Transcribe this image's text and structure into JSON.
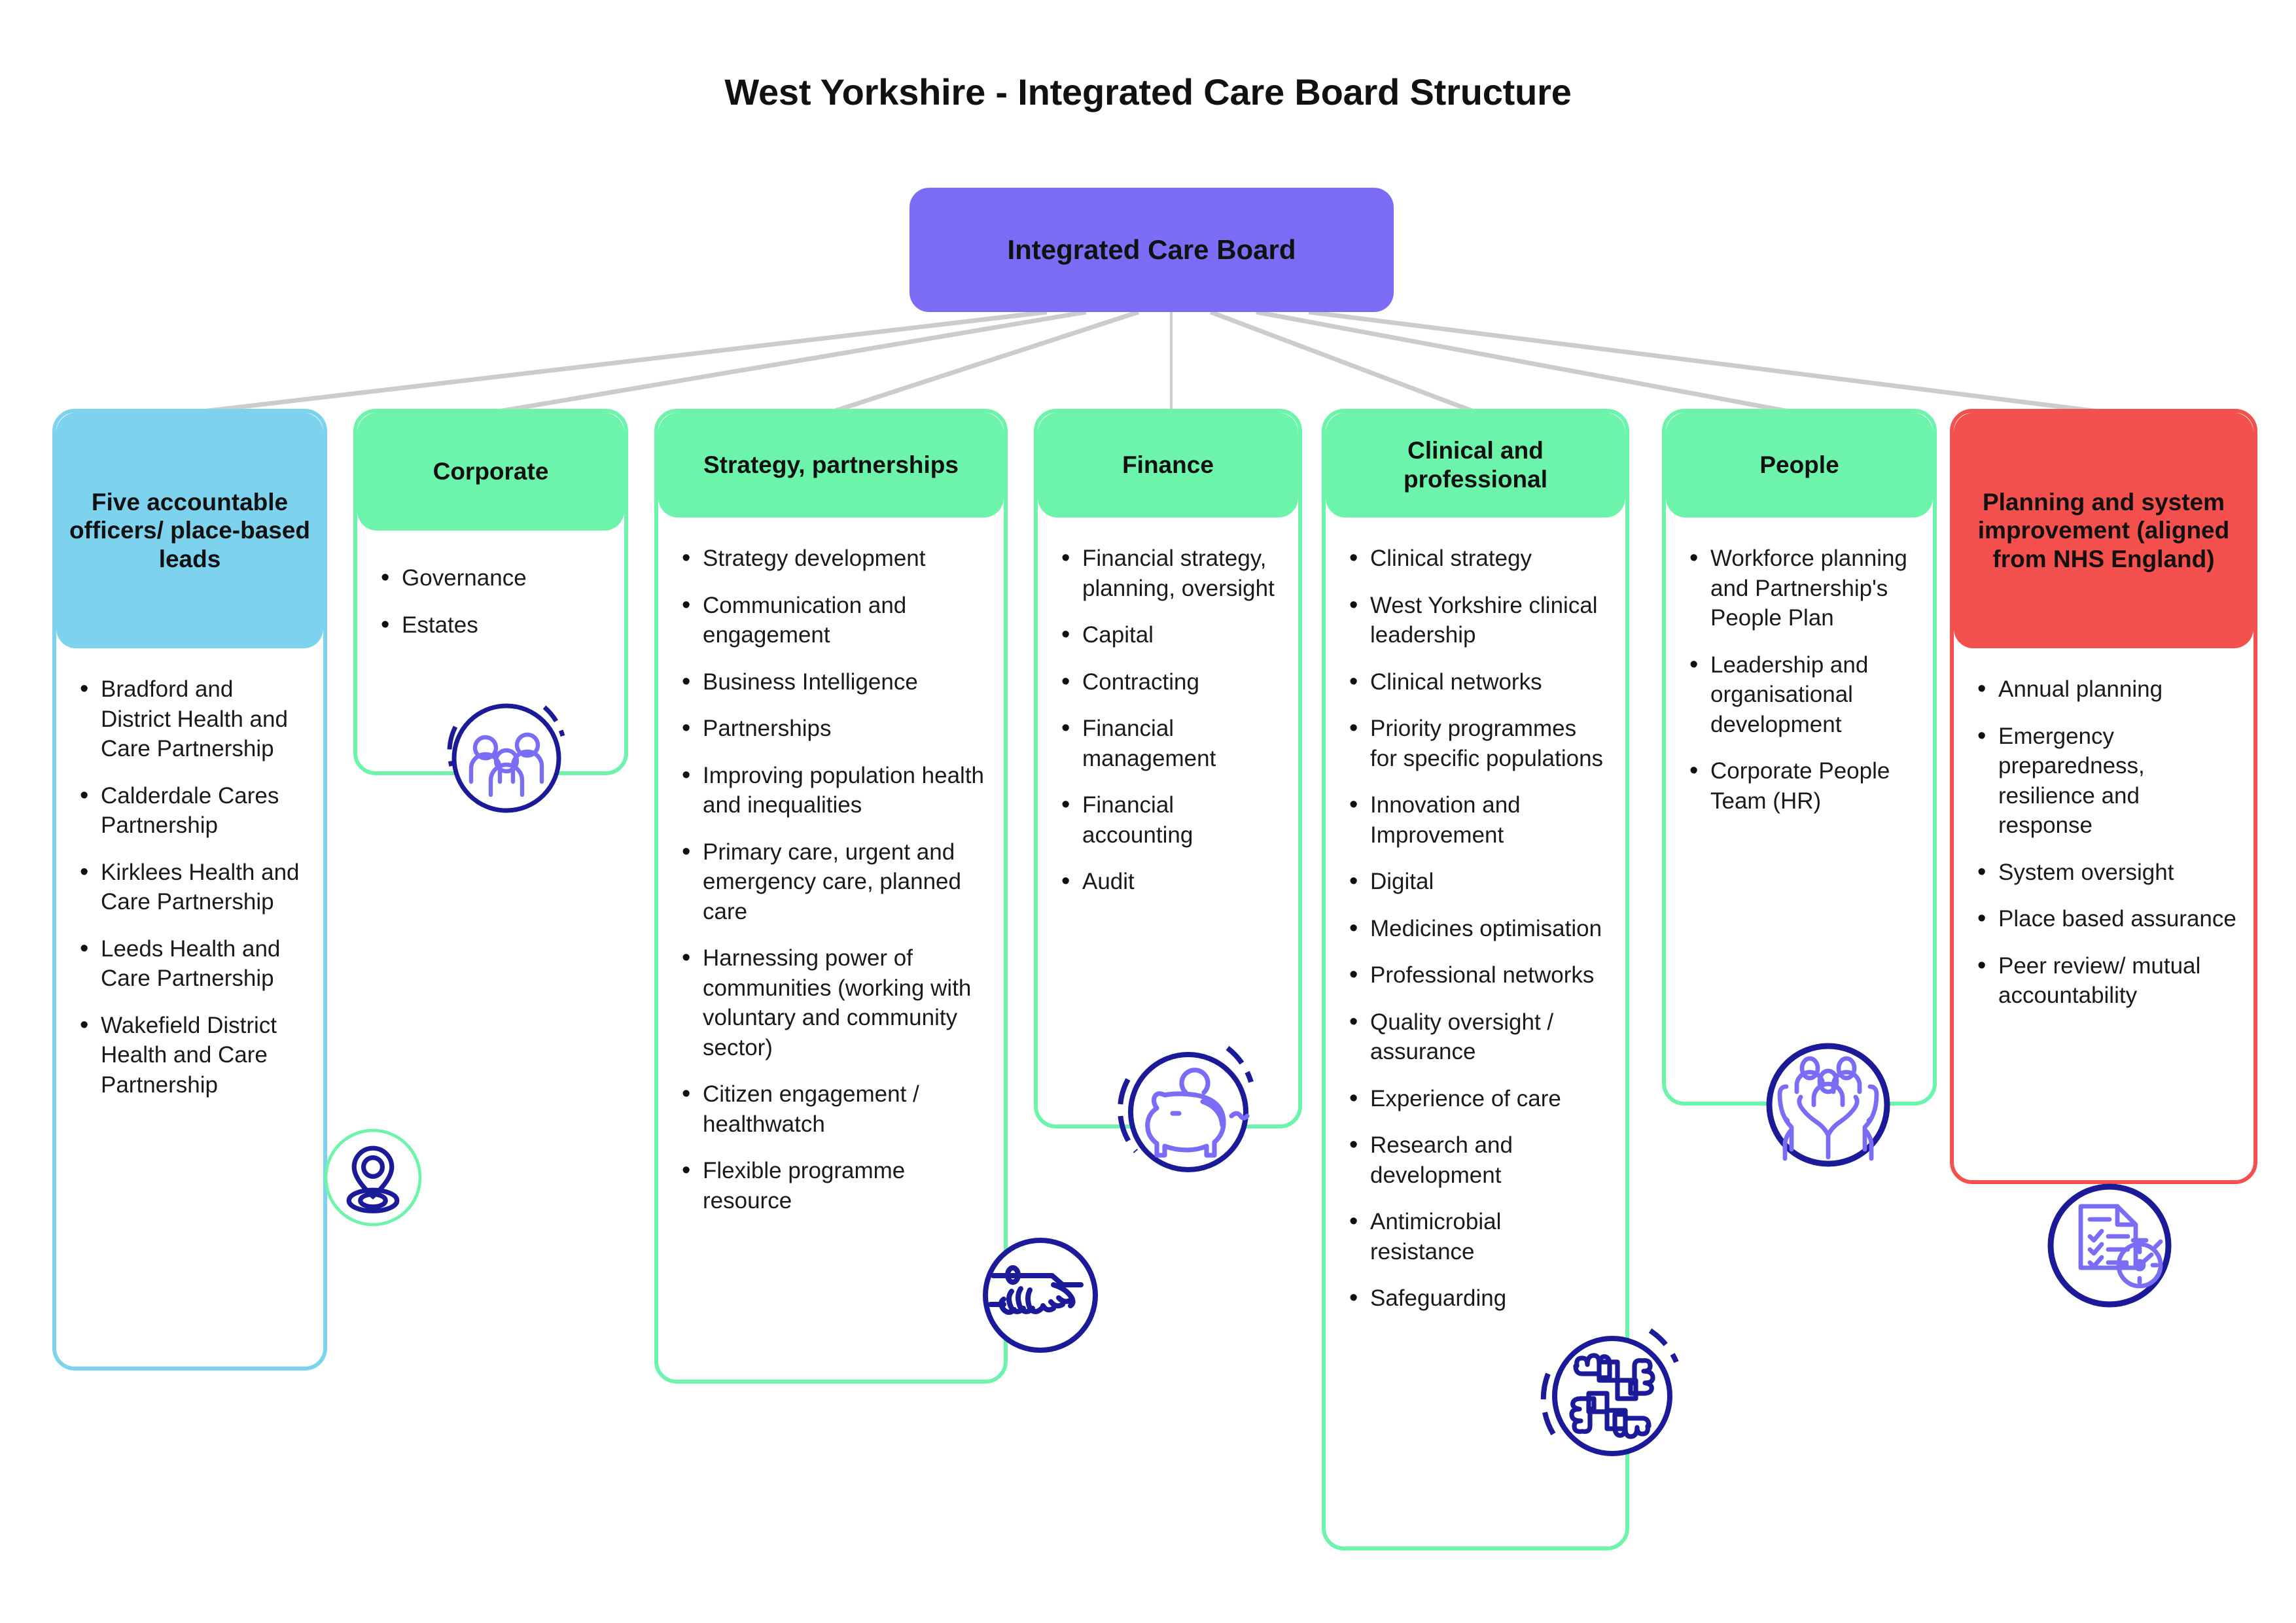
{
  "page": {
    "title": "West Yorkshire - Integrated Care Board Structure"
  },
  "root": {
    "label": "Integrated Care Board",
    "color": "#7b6cf6"
  },
  "colors": {
    "blue": "#7dd3ee",
    "green": "#6df4ab",
    "red": "#f4504d",
    "purple": "#7b6cf6",
    "icon_navy": "#1b1b99",
    "icon_violet": "#7b6cf6",
    "connector": "#cccccc"
  },
  "columns": [
    {
      "id": "five-accountable-officers",
      "title": "Five accountable officers/ place-based leads",
      "header_color": "#7dd3ee",
      "icon": "location-pin-icon",
      "items": [
        "Bradford and District Health and Care Partnership",
        "Calderdale Cares Partnership",
        "Kirklees Health and Care Partnership",
        "Leeds Health and Care Partnership",
        "Wakefield District Health and Care Partnership"
      ]
    },
    {
      "id": "corporate",
      "title": "Corporate",
      "header_color": "#6df4ab",
      "icon": "people-group-icon",
      "items": [
        "Governance",
        "Estates"
      ]
    },
    {
      "id": "strategy-partnerships",
      "title": "Strategy, partnerships",
      "header_color": "#6df4ab",
      "icon": "handshake-icon",
      "items": [
        "Strategy development",
        "Communication and engagement",
        "Business Intelligence",
        "Partnerships",
        "Improving population health and inequalities",
        "Primary care, urgent and emergency care, planned care",
        "Harnessing power of communities (working with voluntary and community sector)",
        "Citizen engagement / healthwatch",
        "Flexible programme resource"
      ]
    },
    {
      "id": "finance",
      "title": "Finance",
      "header_color": "#6df4ab",
      "icon": "piggy-bank-icon",
      "items": [
        "Financial strategy, planning, oversight",
        "Capital",
        "Contracting",
        "Financial management",
        "Financial accounting",
        "Audit"
      ]
    },
    {
      "id": "clinical-and-professional",
      "title": "Clinical and professional",
      "header_color": "#6df4ab",
      "icon": "teamwork-hands-icon",
      "items": [
        "Clinical strategy",
        "West Yorkshire clinical leadership",
        "Clinical networks",
        "Priority programmes for specific populations",
        "Innovation and Improvement",
        "Digital",
        "Medicines optimisation",
        "Professional networks",
        "Quality oversight / assurance",
        "Experience of care",
        "Research and development",
        "Antimicrobial resistance",
        "Safeguarding"
      ]
    },
    {
      "id": "people",
      "title": "People",
      "header_color": "#6df4ab",
      "icon": "hands-holding-people-icon",
      "items": [
        "Workforce planning and Partnership's People Plan",
        "Leadership and organisational development",
        "Corporate People Team (HR)"
      ]
    },
    {
      "id": "planning-and-system-improvement",
      "title": "Planning and system improvement (aligned from NHS England)",
      "header_color": "#f4504d",
      "icon": "checklist-stopwatch-icon",
      "items": [
        "Annual planning",
        "Emergency preparedness, resilience and response",
        "System oversight",
        "Place based assurance",
        "Peer review/ mutual accountability"
      ]
    }
  ]
}
